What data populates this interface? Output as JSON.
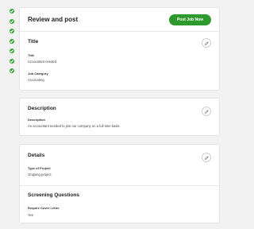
{
  "steps": {
    "completed_count": 7,
    "icon": "check-circle-icon",
    "color": "#3aa83a"
  },
  "header": {
    "title": "Review and post",
    "post_button_label": "Post Job Now",
    "accent_color": "#2e9a2e"
  },
  "title_section": {
    "heading": "Title",
    "fields": [
      {
        "label": "Title",
        "value": "Accountant needed"
      },
      {
        "label": "Job Category",
        "value": "Accounting"
      }
    ]
  },
  "description_section": {
    "heading": "Description",
    "fields": [
      {
        "label": "Description",
        "value": "An accountant needed to join our company on a full time basis."
      }
    ]
  },
  "details_section": {
    "heading": "Details",
    "fields": [
      {
        "label": "Type of Project",
        "value": "Ongoing project"
      }
    ]
  },
  "screening_section": {
    "heading": "Screening Questions",
    "fields": [
      {
        "label": "Require Cover Letter",
        "value": "Yes"
      }
    ]
  },
  "edit_icon": "pencil-icon"
}
